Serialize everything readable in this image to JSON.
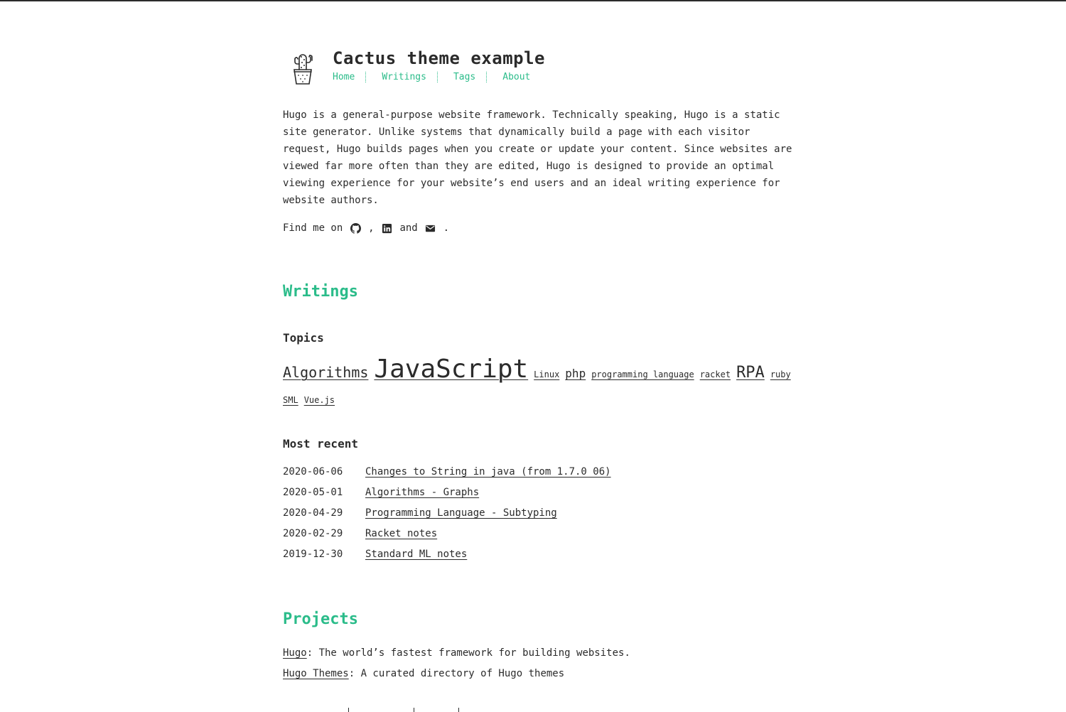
{
  "site": {
    "title": "Cactus theme example"
  },
  "nav": {
    "items": [
      {
        "label": "Home"
      },
      {
        "label": "Writings"
      },
      {
        "label": "Tags"
      },
      {
        "label": "About"
      }
    ]
  },
  "intro": {
    "text": "Hugo is a general-purpose website framework. Technically speaking, Hugo is a static site generator. Unlike systems that dynamically build a page with each visitor request, Hugo builds pages when you create or update your content. Since websites are viewed far more often than they are edited, Hugo is designed to provide an optimal viewing experience for your website’s end users and an ideal writing experience for website authors."
  },
  "find_me": {
    "prefix": "Find me on ",
    "comma": " , ",
    "and": " and ",
    "suffix": " ."
  },
  "icons": {
    "github": "github-icon",
    "linkedin": "linkedin-icon",
    "email": "envelope-icon",
    "logo": "cactus-logo"
  },
  "colors": {
    "accent": "#2bbc8a",
    "text": "#2b2b2b",
    "background": "#ffffff"
  },
  "writings": {
    "heading": "Writings",
    "topics_heading": "Topics",
    "tags": [
      {
        "label": "Algorithms"
      },
      {
        "label": "JavaScript"
      },
      {
        "label": "Linux"
      },
      {
        "label": "php"
      },
      {
        "label": "programming language"
      },
      {
        "label": "racket"
      },
      {
        "label": "RPA"
      },
      {
        "label": "ruby"
      },
      {
        "label": "SML"
      },
      {
        "label": "Vue.js"
      }
    ],
    "recent_heading": "Most recent",
    "posts": [
      {
        "date": "2020-06-06",
        "title": "Changes to String in java (from 1.7.0_06)"
      },
      {
        "date": "2020-05-01",
        "title": "Algorithms - Graphs"
      },
      {
        "date": "2020-04-29",
        "title": "Programming Language - Subtyping"
      },
      {
        "date": "2020-02-29",
        "title": "Racket notes"
      },
      {
        "date": "2019-12-30",
        "title": "Standard ML notes"
      }
    ]
  },
  "projects": {
    "heading": "Projects",
    "items": [
      {
        "name": "Hugo",
        "description": ": The world’s fastest framework for building websites."
      },
      {
        "name": "Hugo Themes",
        "description": ": A curated directory of Hugo themes"
      }
    ]
  }
}
